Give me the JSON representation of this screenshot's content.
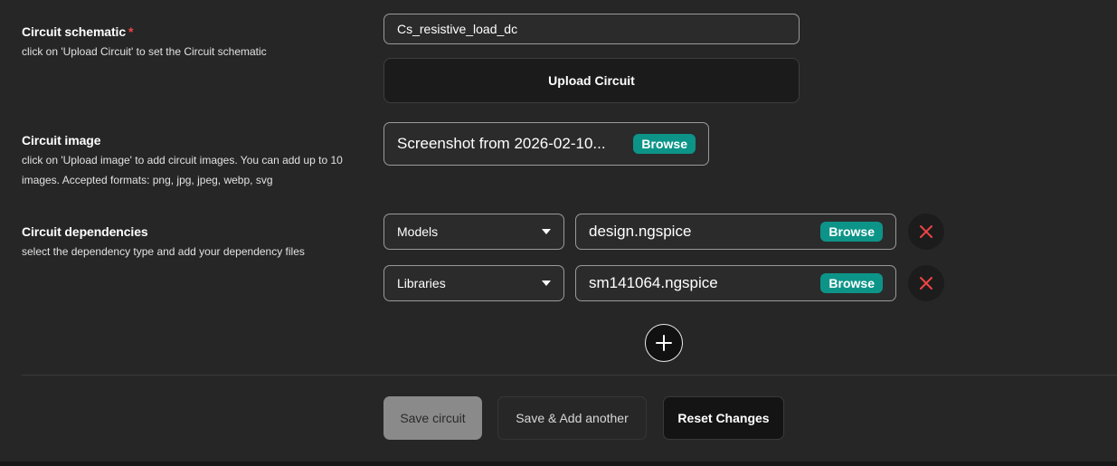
{
  "schematic": {
    "title": "Circuit schematic",
    "required_mark": "*",
    "description": "click on 'Upload Circuit' to set the Circuit schematic",
    "name_value": "Cs_resistive_load_dc",
    "upload_label": "Upload Circuit"
  },
  "image": {
    "title": "Circuit image",
    "description_line1": "click on 'Upload image' to add circuit images. You can add up to 10",
    "description_line2": "images. Accepted formats: png, jpg, jpeg, webp, svg",
    "file_name": "Screenshot from 2026-02-10...",
    "browse_label": "Browse"
  },
  "dependencies": {
    "title": "Circuit dependencies",
    "description": "select the dependency type and add your dependency files",
    "rows": [
      {
        "type": "Models",
        "file_name": "design.ngspice",
        "browse_label": "Browse"
      },
      {
        "type": "Libraries",
        "file_name": "sm141064.ngspice",
        "browse_label": "Browse"
      }
    ]
  },
  "actions": {
    "save_label": "Save circuit",
    "save_add_label": "Save & Add another",
    "reset_label": "Reset Changes"
  },
  "icons": {
    "remove": "close-icon",
    "add": "plus-icon",
    "dropdown": "chevron-down-icon"
  },
  "colors": {
    "background": "#262626",
    "accent": "#0d9488",
    "danger": "#ef4444"
  }
}
